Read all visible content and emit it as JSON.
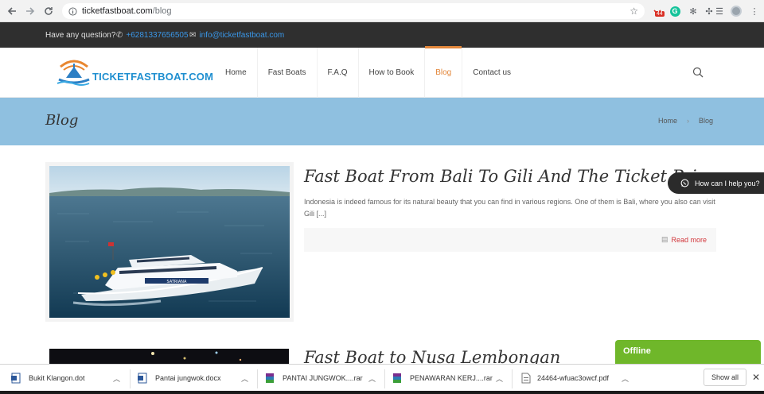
{
  "browser": {
    "url_host": "ticketfastboat.com",
    "url_path": "/blog",
    "extension_badge": "44"
  },
  "topbar": {
    "question": "Have any question?",
    "phone": "+6281337656505",
    "email": "info@ticketfastboat.com"
  },
  "header": {
    "logo_text": "TICKETFASTBOAT.COM",
    "menu": [
      {
        "label": "Home"
      },
      {
        "label": "Fast Boats"
      },
      {
        "label": "F.A.Q"
      },
      {
        "label": "How to Book"
      },
      {
        "label": "Blog"
      },
      {
        "label": "Contact us"
      }
    ],
    "active_color": "#e3873b"
  },
  "page": {
    "title": "Blog",
    "breadcrumb": [
      "Home",
      "Blog"
    ],
    "band_color": "#8fc0e0"
  },
  "posts": [
    {
      "title": "Fast Boat From Bali To Gili And The Ticket Price",
      "excerpt": "Indonesia is indeed famous for its natural beauty that you can find in various regions. One of them is Bali, where you also can visit Gili [...]",
      "read_more": "Read more",
      "boat_name": "SATRIANA"
    },
    {
      "title": "Fast Boat to Nusa Lembongan"
    }
  ],
  "whatsapp": {
    "label": "How can I help you?"
  },
  "chat": {
    "status": "Offline"
  },
  "downloads": {
    "items": [
      {
        "name": "Bukit Klangon.dot",
        "icon": "word-doc-icon"
      },
      {
        "name": "Pantai jungwok.docx",
        "icon": "word-doc-icon"
      },
      {
        "name": "PANTAI JUNGWOK....rar",
        "icon": "rar-archive-icon"
      },
      {
        "name": "PENAWARAN KERJ....rar",
        "icon": "rar-archive-icon"
      },
      {
        "name": "24464-wfuac3owcf.pdf",
        "icon": "pdf-file-icon"
      }
    ],
    "show_all": "Show all"
  }
}
